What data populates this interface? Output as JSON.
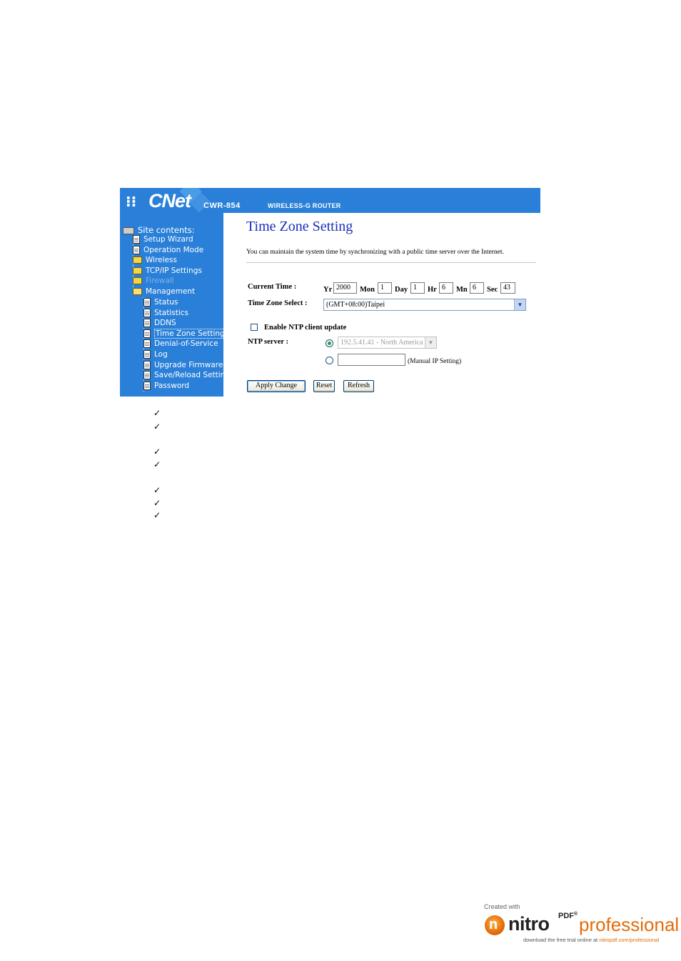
{
  "banner": {
    "logo": "CNet",
    "model": "CWR-854",
    "product": "WIRELESS-G ROUTER"
  },
  "sidebar": {
    "root": "Site contents:",
    "items": [
      {
        "label": "Setup Wizard",
        "type": "doc",
        "level": 1
      },
      {
        "label": "Operation Mode",
        "type": "doc",
        "level": 1
      },
      {
        "label": "Wireless",
        "type": "folder",
        "level": 1
      },
      {
        "label": "TCP/IP Settings",
        "type": "folder",
        "level": 1
      },
      {
        "label": "Firewall",
        "type": "folder",
        "level": 1,
        "disabled": true
      },
      {
        "label": "Management",
        "type": "folder-open",
        "level": 1
      },
      {
        "label": "Status",
        "type": "doc",
        "level": 2
      },
      {
        "label": "Statistics",
        "type": "doc",
        "level": 2
      },
      {
        "label": "DDNS",
        "type": "doc",
        "level": 2
      },
      {
        "label": "Time Zone Setting",
        "type": "doc",
        "level": 2,
        "selected": true
      },
      {
        "label": "Denial-of-Service",
        "type": "doc",
        "level": 2
      },
      {
        "label": "Log",
        "type": "doc",
        "level": 2
      },
      {
        "label": "Upgrade Firmware",
        "type": "doc",
        "level": 2
      },
      {
        "label": "Save/Reload Setting",
        "type": "doc",
        "level": 2
      },
      {
        "label": "Password",
        "type": "doc",
        "level": 2
      }
    ]
  },
  "main": {
    "title": "Time Zone Setting",
    "description": "You can maintain the system time by synchronizing with a public time server over the Internet.",
    "current_time": {
      "label": "Current Time :",
      "yr_label": "Yr",
      "yr": "2000",
      "mon_label": "Mon",
      "mon": "1",
      "day_label": "Day",
      "day": "1",
      "hr_label": "Hr",
      "hr": "6",
      "mn_label": "Mn",
      "mn": "6",
      "sec_label": "Sec",
      "sec": "43"
    },
    "time_zone": {
      "label": "Time Zone Select :",
      "selected": "(GMT+08:00)Taipei"
    },
    "ntp": {
      "enable_label": "Enable NTP client update",
      "enabled": false,
      "server_label": "NTP server :",
      "server_selected": "192.5.41.41 - North America",
      "manual_value": "",
      "manual_note": "(Manual IP Setting)"
    },
    "buttons": {
      "apply": "Apply Change",
      "reset": "Reset",
      "refresh": "Refresh"
    }
  },
  "checkmarks": [
    "✓",
    "✓",
    "✓",
    "✓",
    "✓",
    "✓",
    "✓"
  ],
  "footer_badge": {
    "created_with": "Created with",
    "brand": "nitro",
    "pdf": "PDF",
    "reg": "®",
    "edition": "professional",
    "note_prefix": "download the free trial online at ",
    "note_link": "nitropdf.com/professional"
  }
}
